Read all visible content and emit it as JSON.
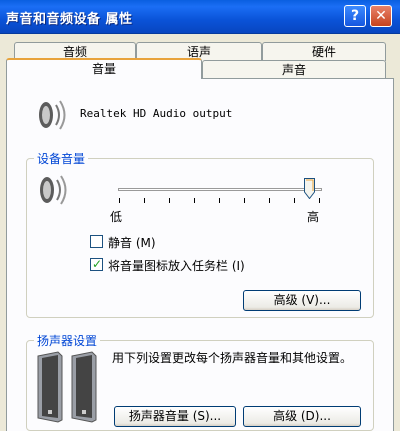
{
  "window": {
    "title": "声音和音频设备 属性",
    "help_glyph": "?",
    "close_glyph": "✕"
  },
  "tabs": {
    "row1": [
      "音频",
      "语声",
      "硬件"
    ],
    "row2": [
      "音量",
      "声音"
    ],
    "active": "音量"
  },
  "device": {
    "name": "Realtek HD Audio output",
    "icon": "speaker-icon"
  },
  "device_volume": {
    "title": "设备音量",
    "icon": "speaker-icon",
    "low_label": "低",
    "high_label": "高",
    "level": 1.0,
    "mute_label": "静音 (M)",
    "mute_checked": false,
    "tray_label": "将音量图标放入任务栏 (I)",
    "tray_checked": true,
    "advanced_button": "高级 (V)..."
  },
  "speaker_settings": {
    "title": "扬声器设置",
    "icon": "speakers-icon",
    "description": "用下列设置更改每个扬声器音量和其他设置。",
    "volume_button": "扬声器音量 (S)...",
    "advanced_button": "高级 (D)..."
  }
}
